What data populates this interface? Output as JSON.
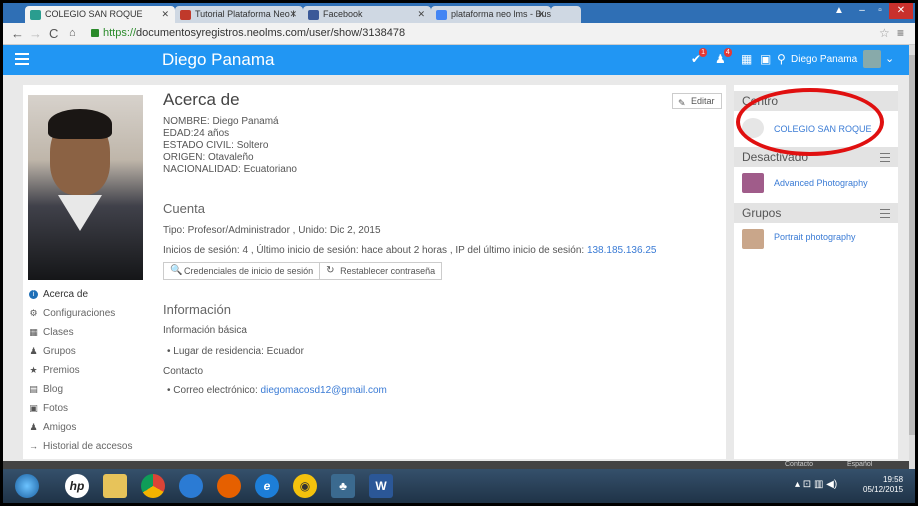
{
  "browser": {
    "tabs": [
      {
        "label": "COLEGIO SAN ROQUE",
        "favicon_color": "#2a9d8f",
        "active": true
      },
      {
        "label": "Tutorial Plataforma Neo I",
        "favicon_color": "#c0392b",
        "active": false
      },
      {
        "label": "Facebook",
        "favicon_color": "#3b5998",
        "active": false
      },
      {
        "label": "plataforma neo lms - Bus",
        "favicon_color": "#4285f4",
        "active": false
      }
    ],
    "url_scheme": "https://",
    "url_rest": "documentosyregistros.neolms.com/user/show/3138478"
  },
  "header": {
    "app_title": "Diego Panama",
    "user_name": "Diego Panama",
    "notif_count_1": "1",
    "notif_count_2": "4",
    "accent": "#2196f3"
  },
  "sidebar": {
    "items": [
      {
        "label": "Acerca de",
        "icon": "info-icon",
        "glyph": "i"
      },
      {
        "label": "Configuraciones",
        "icon": "gear-icon",
        "glyph": "⚙"
      },
      {
        "label": "Clases",
        "icon": "classes-icon",
        "glyph": "▦"
      },
      {
        "label": "Grupos",
        "icon": "groups-icon",
        "glyph": "♟"
      },
      {
        "label": "Premios",
        "icon": "star-icon",
        "glyph": "★"
      },
      {
        "label": "Blog",
        "icon": "blog-icon",
        "glyph": "▤"
      },
      {
        "label": "Fotos",
        "icon": "photo-icon",
        "glyph": "▣"
      },
      {
        "label": "Amigos",
        "icon": "friends-icon",
        "glyph": "♟"
      },
      {
        "label": "Historial de accesos",
        "icon": "arrow-right-icon",
        "glyph": "→"
      }
    ]
  },
  "about": {
    "title": "Acerca de",
    "edit_label": "Editar",
    "nombre": "NOMBRE: Diego Panamá",
    "edad": "EDAD:24 años",
    "estado": "ESTADO CIVIL: Soltero",
    "origen": "ORIGEN: Otavaleño",
    "nacionalidad": "NACIONALIDAD: Ecuatoriano"
  },
  "cuenta": {
    "title": "Cuenta",
    "tipo": "Tipo: Profesor/Administrador , Unido: Dic 2, 2015",
    "inicios": "Inicios de sesión: 4 , Último inicio de sesión: hace about 2 horas , IP del último inicio de sesión: ",
    "ip": "138.185.136.25",
    "cred_button": "Credenciales de inicio de sesión",
    "reset_button": "Restablecer contraseña"
  },
  "informacion": {
    "title": "Información",
    "basica": "Información básica",
    "residencia": "Lugar de residencia: Ecuador",
    "contacto": "Contacto",
    "correo_label": "Correo electrónico: ",
    "correo": "diegomacosd12@gmail.com"
  },
  "right": {
    "centro_title": "Centro",
    "centro_item": "COLEGIO SAN ROQUE",
    "desactivado_title": "Desactivado",
    "desactivado_item": "Advanced Photography",
    "grupos_title": "Grupos",
    "grupos_item": "Portrait photography"
  },
  "footer": {
    "contacto": "Contacto",
    "idioma": "Español"
  },
  "taskbar": {
    "time": "19:58",
    "date": "05/12/2015"
  }
}
